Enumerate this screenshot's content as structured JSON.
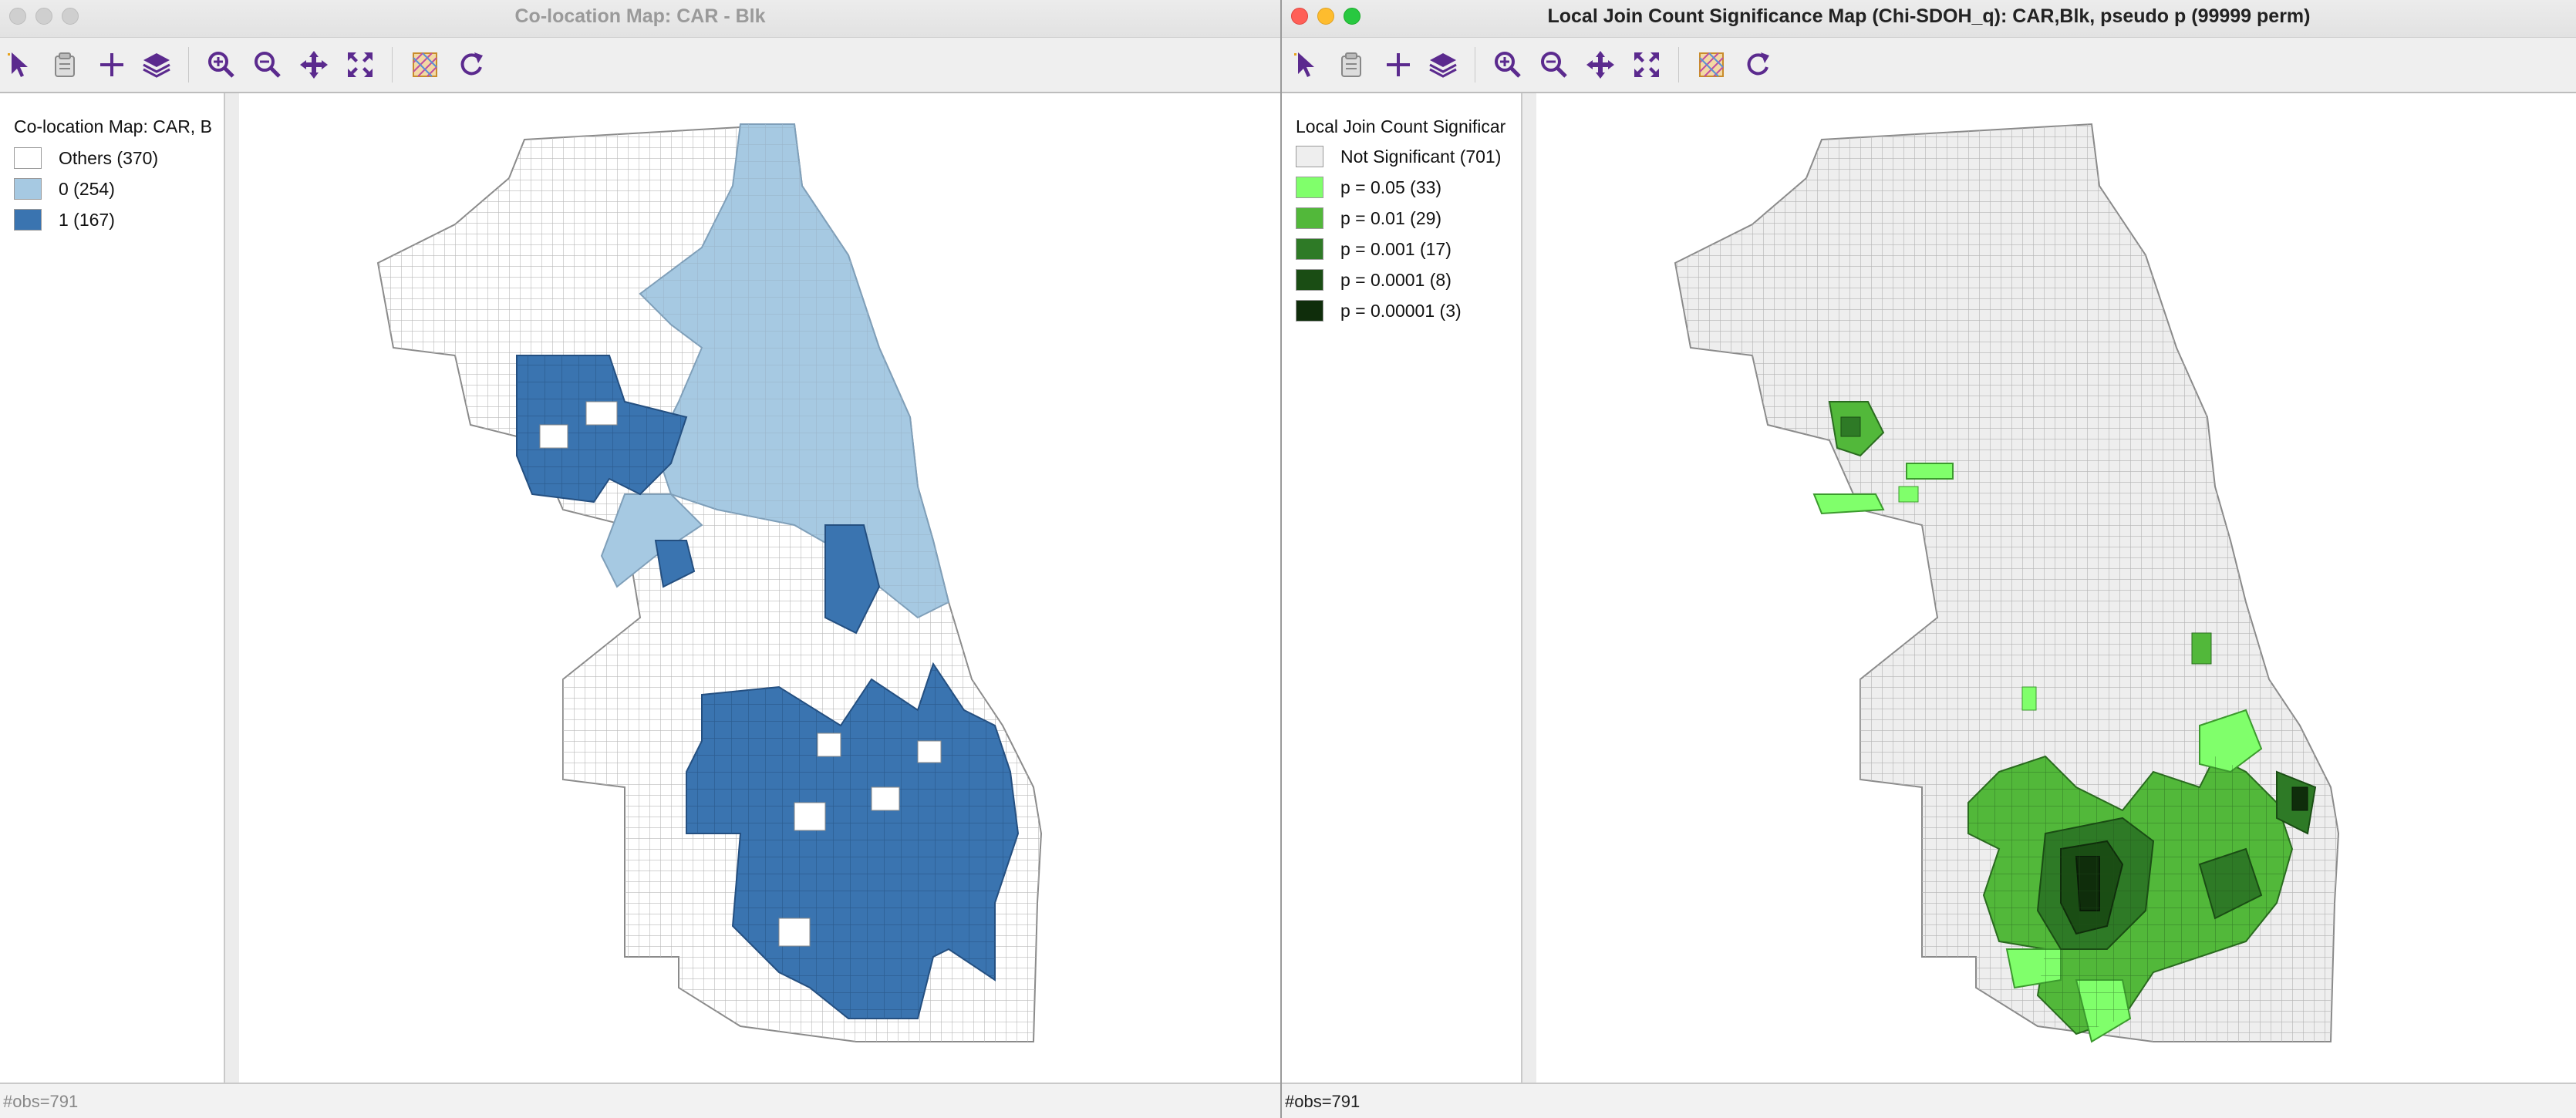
{
  "left_window": {
    "title": "Co-location Map: CAR - Blk",
    "legend": {
      "title": "Co-location Map: CAR, B",
      "items": [
        {
          "label": "Others (370)",
          "color": "#ffffff"
        },
        {
          "label": "0 (254)",
          "color": "#a6c9e2"
        },
        {
          "label": "1 (167)",
          "color": "#3a74b0"
        }
      ]
    },
    "status": "#obs=791"
  },
  "right_window": {
    "title": "Local Join Count Significance Map (Chi-SDOH_q): CAR,Blk, pseudo p (99999 perm)",
    "legend": {
      "title": "Local Join Count Significar",
      "items": [
        {
          "label": "Not Significant (701)",
          "color": "#eeeeee"
        },
        {
          "label": "p = 0.05 (33)",
          "color": "#80ff6b"
        },
        {
          "label": "p = 0.01 (29)",
          "color": "#52b83a"
        },
        {
          "label": "p = 0.001 (17)",
          "color": "#2e7a26"
        },
        {
          "label": "p = 0.0001 (8)",
          "color": "#1a4d14"
        },
        {
          "label": "p = 0.00001 (3)",
          "color": "#0f2d0b"
        }
      ]
    },
    "status": "#obs=791"
  },
  "toolbar_icons": [
    "select-icon",
    "copy-icon",
    "crosshair-icon",
    "layers-icon",
    "zoom-in-icon",
    "zoom-out-icon",
    "pan-icon",
    "fit-extent-icon",
    "map-theme-icon",
    "refresh-icon"
  ]
}
